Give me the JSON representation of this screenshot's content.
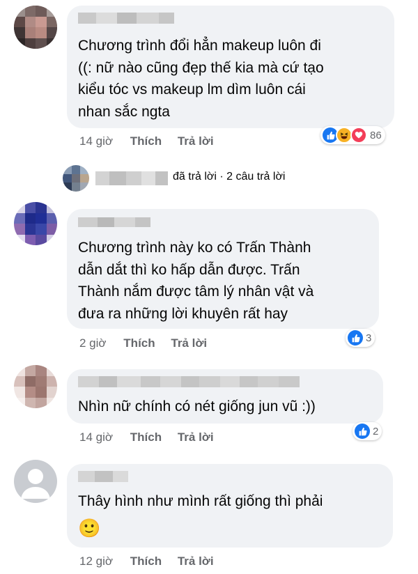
{
  "comments": [
    {
      "text_lines": [
        "Chương trình đổi hẳn makeup luôn đi",
        "((: nữ nào cũng đẹp thế kia mà cứ tạo",
        "kiểu tóc vs makeup lm dìm luôn cái",
        "nhan sắc ngta"
      ],
      "time": "14 giờ",
      "like_label": "Thích",
      "reply_label": "Trả lời",
      "reaction_icons": [
        "like-icon",
        "haha-icon",
        "love-icon"
      ],
      "reaction_count": "86"
    },
    {
      "text_lines": [
        "Chương trình này ko có Trấn Thành",
        "dẫn dắt thì ko hấp dẫn được. Trấn",
        "Thành nắm được tâm lý nhân vật và",
        "đưa ra những lời khuyên rất hay"
      ],
      "time": "2 giờ",
      "like_label": "Thích",
      "reply_label": "Trả lời",
      "reaction_icons": [
        "like-icon"
      ],
      "reaction_count": "3"
    },
    {
      "text_lines": [
        "Nhìn nữ chính có nét giống jun vũ :))"
      ],
      "time": "14 giờ",
      "like_label": "Thích",
      "reply_label": "Trả lời",
      "reaction_icons": [
        "like-icon"
      ],
      "reaction_count": "2"
    },
    {
      "text_lines": [
        "Thây hình như mình rất giống thì phải"
      ],
      "emoji": "🙂",
      "time": "12 giờ",
      "like_label": "Thích",
      "reply_label": "Trả lời"
    }
  ],
  "replies_summary": {
    "text": "đã trả lời · 2 câu trả lời"
  },
  "colors": {
    "bubble": "#f0f2f5",
    "meta_text": "#65676b",
    "like_blue": "#1877f2",
    "love_red": "#f33e58",
    "haha_yellow": "#f7b125"
  }
}
